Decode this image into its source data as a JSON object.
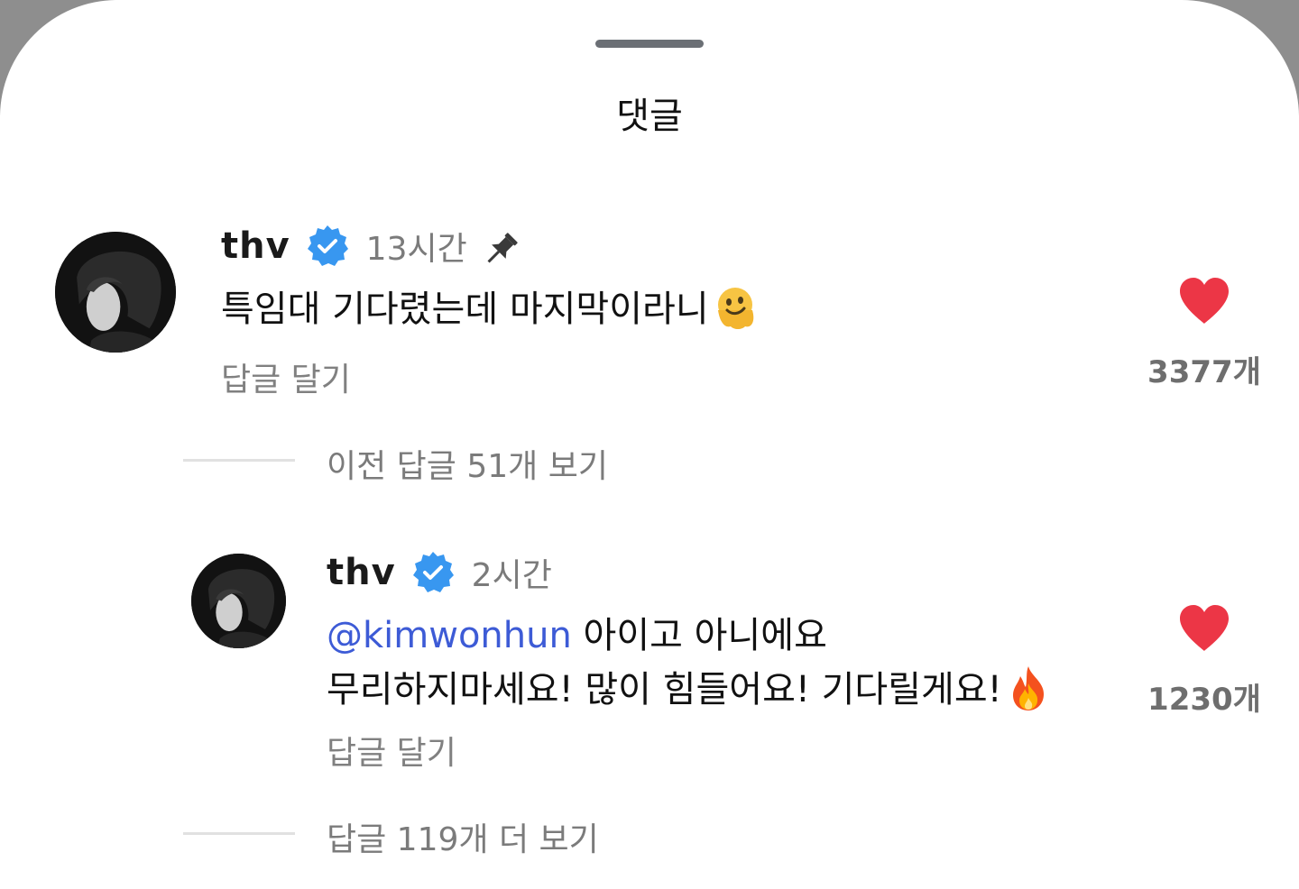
{
  "sheet": {
    "title": "댓글"
  },
  "comments": [
    {
      "username": "thv",
      "time": "13시간",
      "text": "특임대 기다렸는데 마지막이라니",
      "emoji_icon": "melting-face-icon",
      "reply_label": "답글 달기",
      "like_count": "3377개"
    }
  ],
  "thread": {
    "previous_label": "이전 답글 51개 보기",
    "replies": [
      {
        "username": "thv",
        "time": "2시간",
        "mention": "@kimwonhun",
        "line1": " 아이고 아니에요",
        "line2": "무리하지마세요! 많이 힘들어요! 기다릴게요!",
        "emoji_icon": "fire-icon",
        "reply_label": "답글 달기",
        "like_count": "1230개"
      }
    ],
    "more_label": "답글 119개 더 보기"
  },
  "colors": {
    "heart": "#ec3646",
    "verified": "#3897f0",
    "mention": "#3d5bd6"
  }
}
